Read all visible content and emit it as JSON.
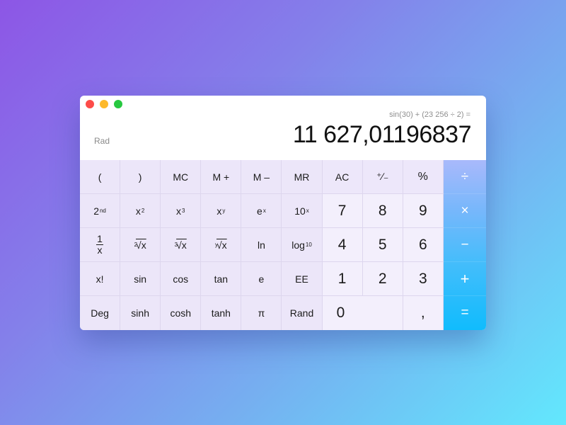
{
  "window": {
    "controls": [
      "close",
      "minimize",
      "maximize"
    ]
  },
  "display": {
    "mode": "Rad",
    "expression": "sin(30) + (23 256 ÷ 2) =",
    "result": "11 627,01196837"
  },
  "keys": {
    "row1": {
      "lparen": "(",
      "rparen": ")",
      "mc": "MC",
      "mplus": "M +",
      "mminus": "M –",
      "mr": "MR",
      "ac": "AC",
      "plusminus": "⁺∕₋",
      "percent": "%"
    },
    "row2": {
      "second_base": "2",
      "second_sup": "nd",
      "x2_base": "x",
      "x2_sup": "2",
      "x3_base": "x",
      "x3_sup": "3",
      "xy_base": "x",
      "xy_sup": "y",
      "ex_base": "e",
      "ex_sup": "x",
      "tenx_base": "10",
      "tenx_sup": "x",
      "seven": "7",
      "eight": "8",
      "nine": "9"
    },
    "row3": {
      "inv_num": "1",
      "inv_den": "x",
      "sqrt_idx": "2",
      "sqrt_body": "√x",
      "cbrt_idx": "3",
      "cbrt_body": "√x",
      "yroot_idx": "y",
      "yroot_body": "√x",
      "ln": "ln",
      "log_base": "log",
      "log_sub": "10",
      "four": "4",
      "five": "5",
      "six": "6"
    },
    "row4": {
      "fact": "x!",
      "sin": "sin",
      "cos": "cos",
      "tan": "tan",
      "e": "e",
      "ee": "EE",
      "one": "1",
      "two": "2",
      "three": "3"
    },
    "row5": {
      "deg": "Deg",
      "sinh": "sinh",
      "cosh": "cosh",
      "tanh": "tanh",
      "pi": "π",
      "rand": "Rand",
      "zero": "0",
      "decimal": ","
    },
    "operators": {
      "divide": "÷",
      "multiply": "×",
      "subtract": "−",
      "add": "+",
      "equals": "="
    }
  },
  "colors": {
    "close": "#fd4c49",
    "minimize": "#fdb92b",
    "maximize": "#27c840",
    "operator_top": "#a9b9fb",
    "operator_bottom": "#10bcfd"
  }
}
